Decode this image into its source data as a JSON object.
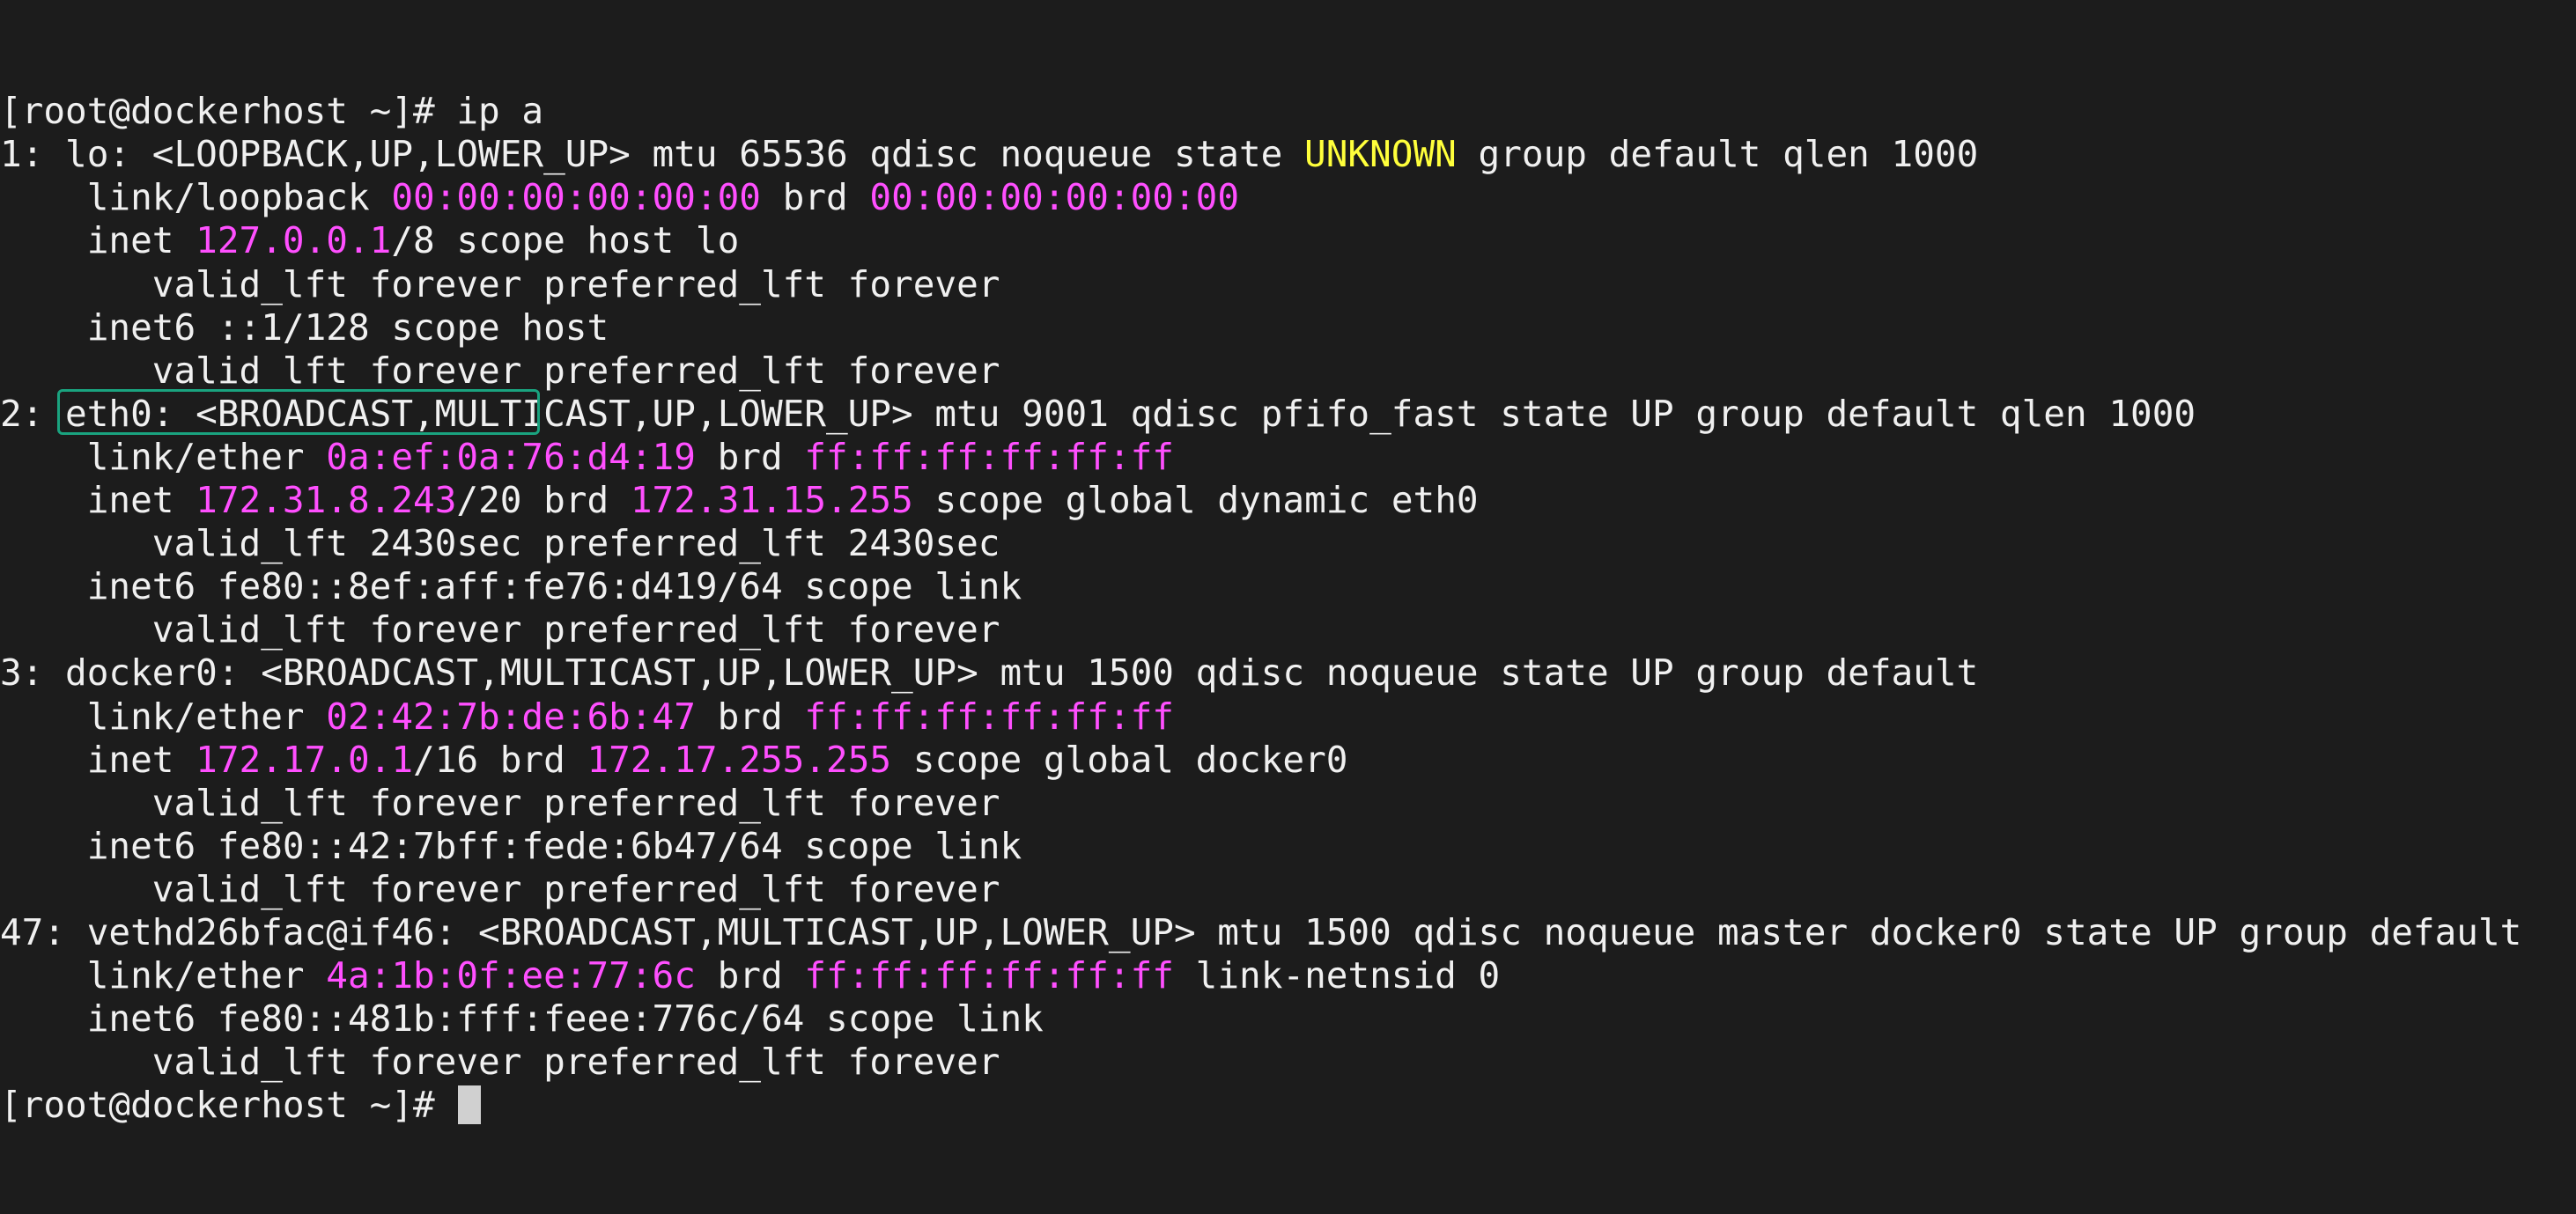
{
  "prompt": "[root@dockerhost ~]# ",
  "command": "ip a",
  "colors": {
    "background": "#1c1c1c",
    "text": "#f0f0f0",
    "address": "#ff4fff",
    "state_unknown": "#ffff3b",
    "highlight_box": "#1aa37f"
  },
  "lines": [
    [
      {
        "t": "[root@dockerhost ~]# ip a"
      }
    ],
    [
      {
        "t": "1: lo: <LOOPBACK,UP,LOWER_UP> mtu 65536 qdisc noqueue state "
      },
      {
        "t": "UNKNOWN",
        "c": "yel"
      },
      {
        "t": " group default qlen 1000"
      }
    ],
    [
      {
        "t": "    link/loopback "
      },
      {
        "t": "00:00:00:00:00:00",
        "c": "mag"
      },
      {
        "t": " brd "
      },
      {
        "t": "00:00:00:00:00:00",
        "c": "mag"
      }
    ],
    [
      {
        "t": "    inet "
      },
      {
        "t": "127.0.0.1",
        "c": "mag"
      },
      {
        "t": "/8 scope host lo"
      }
    ],
    [
      {
        "t": "       valid_lft forever preferred_lft forever"
      }
    ],
    [
      {
        "t": "    inet6 ::1/128 scope host"
      }
    ],
    [
      {
        "t": "       valid_lft forever preferred_lft forever"
      }
    ],
    [
      {
        "t": "2: eth0: <BROADCAST,MULTICAST,UP,LOWER_UP> mtu 9001 qdisc pfifo_fast state UP group default qlen 1000"
      }
    ],
    [
      {
        "t": "    link/ether "
      },
      {
        "t": "0a:ef:0a:76:d4:19",
        "c": "mag"
      },
      {
        "t": " brd "
      },
      {
        "t": "ff:ff:ff:ff:ff:ff",
        "c": "mag"
      }
    ],
    [
      {
        "t": "    inet "
      },
      {
        "t": "172.31.8.243",
        "c": "mag"
      },
      {
        "t": "/20 brd "
      },
      {
        "t": "172.31.15.255",
        "c": "mag"
      },
      {
        "t": " scope global dynamic eth0"
      }
    ],
    [
      {
        "t": "       valid_lft 2430sec preferred_lft 2430sec"
      }
    ],
    [
      {
        "t": "    inet6 fe80::8ef:aff:fe76:d419/64 scope link"
      }
    ],
    [
      {
        "t": "       valid_lft forever preferred_lft forever"
      }
    ],
    [
      {
        "t": "3: docker0: <BROADCAST,MULTICAST,UP,LOWER_UP> mtu 1500 qdisc noqueue state UP group default"
      }
    ],
    [
      {
        "t": "    link/ether "
      },
      {
        "t": "02:42:7b:de:6b:47",
        "c": "mag"
      },
      {
        "t": " brd "
      },
      {
        "t": "ff:ff:ff:ff:ff:ff",
        "c": "mag"
      }
    ],
    [
      {
        "t": "    inet "
      },
      {
        "t": "172.17.0.1",
        "c": "mag"
      },
      {
        "t": "/16 brd "
      },
      {
        "t": "172.17.255.255",
        "c": "mag"
      },
      {
        "t": " scope global docker0"
      }
    ],
    [
      {
        "t": "       valid_lft forever preferred_lft forever"
      }
    ],
    [
      {
        "t": "    inet6 fe80::42:7bff:fede:6b47/64 scope link"
      }
    ],
    [
      {
        "t": "       valid_lft forever preferred_lft forever"
      }
    ],
    [
      {
        "t": "47: vethd26bfac@if46: <BROADCAST,MULTICAST,UP,LOWER_UP> mtu 1500 qdisc noqueue master docker0 state UP group default"
      }
    ],
    [
      {
        "t": "    link/ether "
      },
      {
        "t": "4a:1b:0f:ee:77:6c",
        "c": "mag"
      },
      {
        "t": " brd "
      },
      {
        "t": "ff:ff:ff:ff:ff:ff",
        "c": "mag"
      },
      {
        "t": " link-netnsid 0"
      }
    ],
    [
      {
        "t": "    inet6 fe80::481b:fff:feee:776c/64 scope link"
      }
    ],
    [
      {
        "t": "       valid_lft forever preferred_lft forever"
      }
    ],
    [
      {
        "t": "[root@dockerhost ~]# "
      }
    ]
  ]
}
